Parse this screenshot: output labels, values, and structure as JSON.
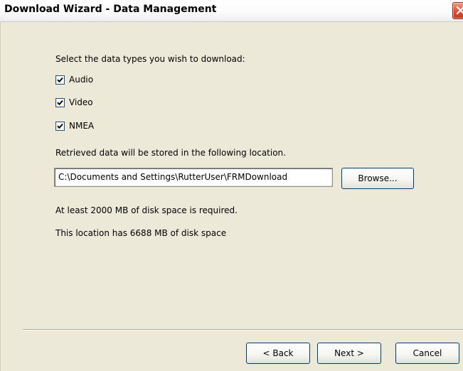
{
  "window": {
    "title": "Download Wizard - Data Management"
  },
  "instructions": {
    "select_types": "Select the data types you wish to download:",
    "storage_location": "Retrieved data will be stored in the following location.",
    "space_required": "At least 2000 MB of disk space is required.",
    "space_available": "This location has 6688 MB of disk space"
  },
  "data_types": [
    {
      "label": "Audio",
      "checked": true
    },
    {
      "label": "Video",
      "checked": true
    },
    {
      "label": "NMEA",
      "checked": true
    }
  ],
  "location": {
    "path": "C:\\Documents and Settings\\RutterUser\\FRMDownload",
    "browse_label": "Browse..."
  },
  "footer": {
    "back_label": "< Back",
    "next_label": "Next >",
    "cancel_label": "Cancel"
  },
  "icons": {
    "close": "close-icon",
    "check": "checkmark-icon"
  },
  "colors": {
    "dialog_background": "#ece9d8",
    "close_button": "#e2583e",
    "button_border": "#003c74"
  }
}
